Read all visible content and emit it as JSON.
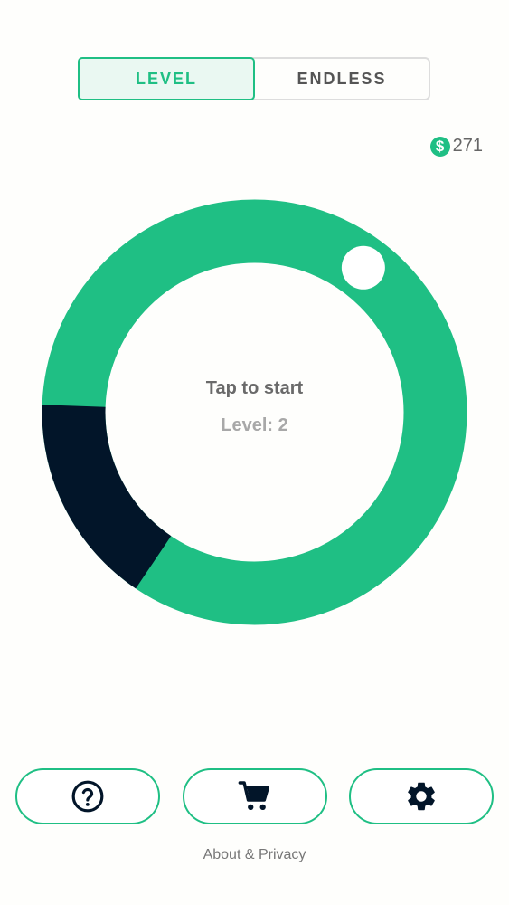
{
  "mode_toggle": {
    "level_label": "LEVEL",
    "endless_label": "ENDLESS",
    "selected": "LEVEL"
  },
  "coins": {
    "symbol": "$",
    "amount": "271"
  },
  "game": {
    "center_text": "Tap to start",
    "level_text": "Level: 2",
    "ring_color": "#1fbf84",
    "target_zone_color": "#021529",
    "target_zone_start_deg": 214,
    "target_zone_end_deg": 272,
    "ball_angle_deg": 37,
    "ball_color": "#ffffff"
  },
  "bottom_buttons": {
    "help_icon": "help-circle-icon",
    "shop_icon": "shopping-cart-icon",
    "settings_icon": "gear-icon"
  },
  "footer": {
    "about_label": "About & Privacy"
  },
  "colors": {
    "accent": "#1fbf84",
    "dark": "#021529",
    "background": "#fefefc"
  }
}
